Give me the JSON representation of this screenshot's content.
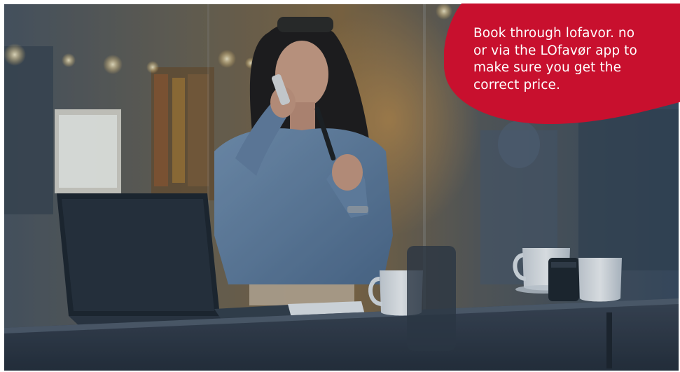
{
  "promo": {
    "message": "Book through lofavor. no or via the LOfavør app to make sure you get the correct price.",
    "background_color": "#c8102e",
    "text_color": "#ffffff"
  },
  "photo": {
    "subject": "woman-on-phone-in-cafe"
  }
}
